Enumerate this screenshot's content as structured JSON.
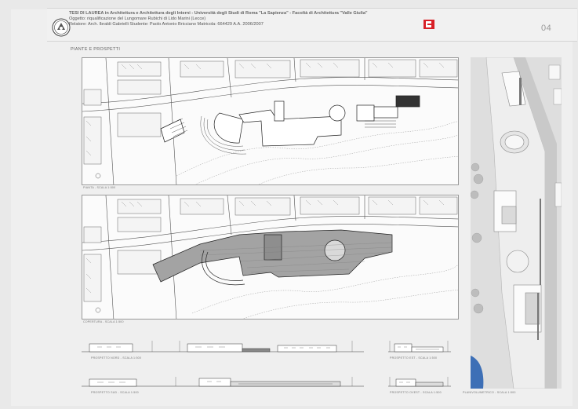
{
  "header": {
    "line1": "TESI DI LAUREA  in Architettura e Architettura degli Interni - Università degli Studi di Roma \"La Sapienza\" - Facoltà di Architettura \"Valle Giulia\"",
    "line2": "Oggetto: riqualificazione del Lungomare Rubichi di Lido Marini (Lecce)",
    "line3": "Relatore: Arch. Ibraldi Gabrielli     Studente: Paolo Antonio Bricciano   Matricola: 664429   A.A. 2006/2007",
    "sheet_number": "04"
  },
  "section_title": "PIANTE E PROSPETTI",
  "captions": {
    "plan_top": "PIANTA - SCALA 1:500",
    "plan_bottom": "COPERTURA - SCALA 1:500",
    "elev_north": "PROSPETTO NORD - SCALA 1:500",
    "elev_south": "PROSPETTO SUD - SCALA 1:500",
    "elev_east": "PROSPETTO EST - SCALA 1:500",
    "elev_west": "PROSPETTO OVEST - SCALA 1:500",
    "view3d": "PLANIVOLUMETRICO - SCALA 1:500"
  },
  "colors": {
    "logo_red": "#d81f26",
    "sea_blue": "#3d6fb6",
    "roof_gray": "#9d9d9d"
  }
}
